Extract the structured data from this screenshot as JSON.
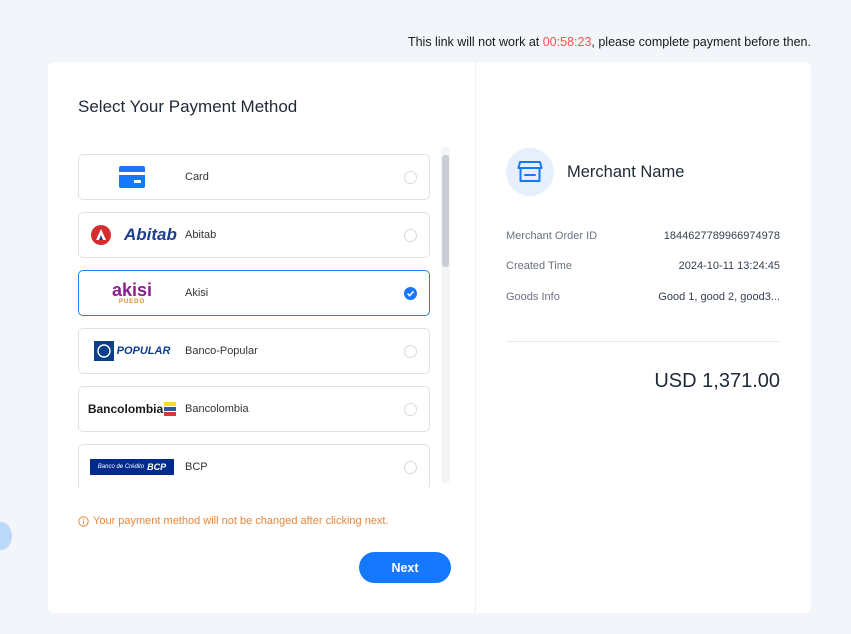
{
  "expiry": {
    "prefix": "This link will not work at ",
    "timer": "00:58:23",
    "suffix": ", please complete payment before then."
  },
  "payment": {
    "title": "Select Your Payment Method",
    "methods": [
      {
        "label": "Card",
        "logo": "card-icon",
        "selected": false
      },
      {
        "label": "Abitab",
        "logo_text": "Abitab",
        "selected": false
      },
      {
        "label": "Akisi",
        "logo_text": "akisi",
        "logo_sub": "PUEDO",
        "selected": true
      },
      {
        "label": "Banco-Popular",
        "logo_text": "POPULAR",
        "selected": false
      },
      {
        "label": "Bancolombia",
        "logo_text": "Bancolombia",
        "selected": false
      },
      {
        "label": "BCP",
        "logo_text": "Banco de Crédito",
        "logo_badge": "BCP",
        "selected": false
      }
    ],
    "warning": "Your payment method will not be changed after clicking next.",
    "next_label": "Next"
  },
  "merchant": {
    "name": "Merchant Name",
    "info": [
      {
        "key": "Merchant Order ID",
        "value": "1844627789966974978"
      },
      {
        "key": "Created Time",
        "value": "2024-10-11 13:24:45"
      },
      {
        "key": "Goods Info",
        "value": "Good 1, good 2, good3..."
      }
    ],
    "amount": "USD 1,371.00"
  },
  "colors": {
    "accent": "#1677ff",
    "timer": "#f0564a",
    "warning": "#e8873a"
  }
}
